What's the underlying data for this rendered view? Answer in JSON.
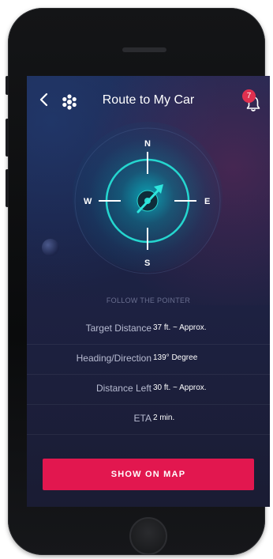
{
  "header": {
    "title": "Route to My Car",
    "notification_count": "7",
    "back_icon": "chevron-left-icon",
    "hub_icon": "hub-icon",
    "bell_icon": "bell-icon"
  },
  "compass": {
    "north": "N",
    "south": "S",
    "east": "E",
    "west": "W"
  },
  "section_label": "FOLLOW THE POINTER",
  "info_rows": [
    {
      "label": "Target Distance",
      "value": "37 ft. ~ Approx."
    },
    {
      "label": "Heading/Direction",
      "value": "139° Degree"
    },
    {
      "label": "Distance Left",
      "value": "30 ft. ~ Approx."
    },
    {
      "label": "ETA",
      "value": "2 min."
    }
  ],
  "cta": {
    "label": "SHOW ON MAP"
  },
  "colors": {
    "accent": "#e2174f",
    "compass_teal": "#19c9c9",
    "badge": "#e0304f",
    "screen_bg": "#1b2347"
  }
}
